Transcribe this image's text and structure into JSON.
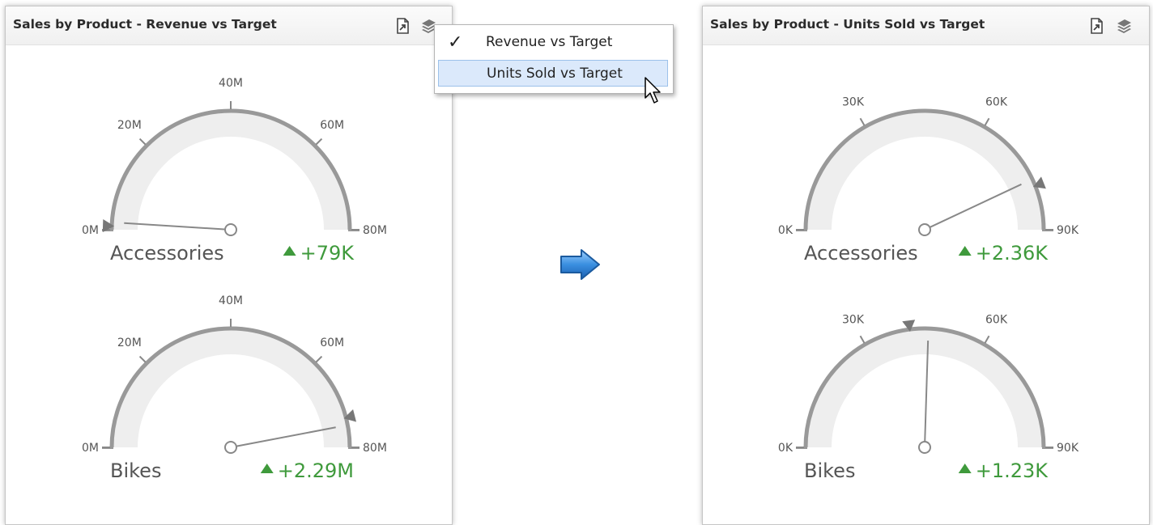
{
  "colors": {
    "accent_positive": "#3f9a3c",
    "gauge_track": "#eeeeee",
    "gauge_arc": "#999999",
    "menu_hover": "#dbe9fb",
    "arrow_blue": "#3a8fe0"
  },
  "panels": [
    {
      "title": "Sales by Product - Revenue vs Target",
      "export_icon": "export-icon",
      "layers_icon": "layers-icon",
      "gauges": [
        {
          "label": "Accessories",
          "delta": "+79K",
          "indicator": "triangle-up",
          "value_fraction": 0.02,
          "target_fraction": 0.01,
          "scale": {
            "min": 0,
            "max": 80,
            "unit": "M"
          },
          "ticks": [
            "0M",
            "20M",
            "40M",
            "60M",
            "80M"
          ]
        },
        {
          "label": "Bikes",
          "delta": "+2.29M",
          "indicator": "triangle-up",
          "value_fraction": 0.94,
          "target_fraction": 0.92,
          "scale": {
            "min": 0,
            "max": 80,
            "unit": "M"
          },
          "ticks": [
            "0M",
            "20M",
            "40M",
            "60M",
            "80M"
          ]
        }
      ]
    },
    {
      "title": "Sales by Product - Units Sold vs Target",
      "export_icon": "export-icon",
      "layers_icon": "layers-icon",
      "gauges": [
        {
          "label": "Accessories",
          "delta": "+2.36K",
          "indicator": "triangle-up",
          "value_fraction": 0.86,
          "target_fraction": 0.88,
          "scale": {
            "min": 0,
            "max": 90,
            "unit": "K"
          },
          "ticks": [
            "0K",
            "30K",
            "60K",
            "90K"
          ]
        },
        {
          "label": "Bikes",
          "delta": "+1.23K",
          "indicator": "triangle-up",
          "value_fraction": 0.51,
          "target_fraction": 0.46,
          "scale": {
            "min": 0,
            "max": 90,
            "unit": "K"
          },
          "ticks": [
            "0K",
            "30K",
            "60K",
            "90K"
          ]
        }
      ]
    }
  ],
  "menu": {
    "items": [
      {
        "label": "Revenue vs Target",
        "checked": true,
        "check_icon": "checkmark-icon"
      },
      {
        "label": "Units Sold vs Target",
        "checked": false,
        "hovered": true
      }
    ]
  },
  "arrow_icon": "right-arrow-icon",
  "cursor_icon": "mouse-pointer-icon"
}
